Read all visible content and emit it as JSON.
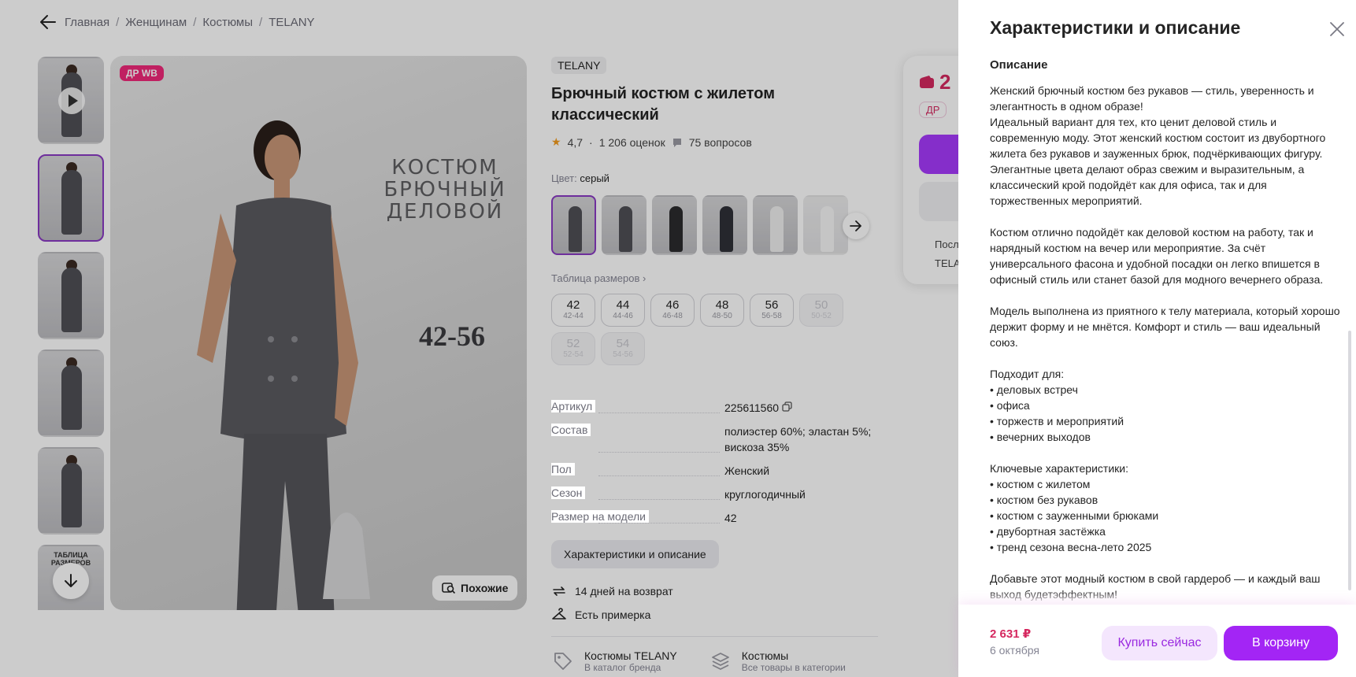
{
  "breadcrumbs": [
    "Главная",
    "Женщинам",
    "Костюмы",
    "TELANY"
  ],
  "gallery": {
    "badge": "ДР WB",
    "photo_title": "КОСТЮМ БРЮЧНЫЙ ДЕЛОВОЙ",
    "photo_sizes": "42-56",
    "thumb_text": "ТАБЛИЦА РАЗМЕРОВ",
    "similar_label": "Похожие"
  },
  "product": {
    "brand": "TELANY",
    "title": "Брючный костюм с жилетом классический",
    "rating": "4,7",
    "reviews": "1 206 оценок",
    "questions": "75 вопросов",
    "color_label": "Цвет:",
    "color_value": "серый",
    "size_table_label": "Таблица размеров",
    "sizes": [
      {
        "n": "42",
        "r": "42-44",
        "available": true
      },
      {
        "n": "44",
        "r": "44-46",
        "available": true
      },
      {
        "n": "46",
        "r": "46-48",
        "available": true
      },
      {
        "n": "48",
        "r": "48-50",
        "available": true
      },
      {
        "n": "56",
        "r": "56-58",
        "available": true
      },
      {
        "n": "50",
        "r": "50-52",
        "available": false
      },
      {
        "n": "52",
        "r": "52-54",
        "available": false
      },
      {
        "n": "54",
        "r": "54-56",
        "available": false
      }
    ],
    "specs": [
      {
        "k": "Артикул",
        "v": "225611560"
      },
      {
        "k": "Состав",
        "v": "полиэстер 60%; эластан 5%; вискоза 35%"
      },
      {
        "k": "Пол",
        "v": "Женский"
      },
      {
        "k": "Сезон",
        "v": "круглогодичный"
      },
      {
        "k": "Размер на модели",
        "v": "42"
      }
    ],
    "char_button": "Характеристики и описание",
    "perks": [
      "14 дней на возврат",
      "Есть примерка"
    ],
    "categories": [
      {
        "title": "Костюмы TELANY",
        "sub": "В каталог бренда"
      },
      {
        "title": "Костюмы",
        "sub": "Все товары в категории"
      }
    ]
  },
  "buy_card": {
    "price_fragment": "2",
    "tag_fragment": "ДР",
    "line1": "Посл",
    "line2": "TELA"
  },
  "drawer": {
    "title": "Характеристики и описание",
    "section_title": "Описание",
    "description": "Женский брючный костюм без рукавов — стиль, уверенность и элегантность в одном образе!\nИдеальный вариант для тех, кто ценит деловой стиль и современную моду. Этот женский костюм состоит из двубортного жилета без рукавов и зауженных брюк, подчёркивающих фигуру. Элегантные цвета делают образ свежим и выразительным, а классический крой подойдёт как для офиса, так и для торжественных мероприятий.\n\nКостюм отлично подойдёт как деловой костюм на работу, так и нарядный костюм на вечер или мероприятие. За счёт универсального фасона и удобной посадки он легко впишется в офисный стиль или станет базой для модного вечернего образа.\n\nМодель выполнена из приятного к телу материала, который хорошо держит форму и не мнётся. Комфорт и стиль — ваш идеальный союз.\n\nПодходит для:\n• деловых встреч\n• офиса\n• торжеств и мероприятий\n• вечерних выходов\n\nКлючевые характеристики:\n• костюм с жилетом\n• костюм без рукавов\n• костюм с зауженными брюками\n• двубортная застёжка\n• тренд сезона весна-лето 2025\n\nДобавьте этот модный костюм в свой гардероб — и каждый ваш выход будетэффектным!",
    "price": "2 631 ₽",
    "delivery": "6 октября",
    "buy_now": "Купить сейчас",
    "add_to_cart": "В корзину"
  },
  "colors": {
    "accent": "#a325f5",
    "price": "#d5285f",
    "badge": "#f0287a"
  }
}
